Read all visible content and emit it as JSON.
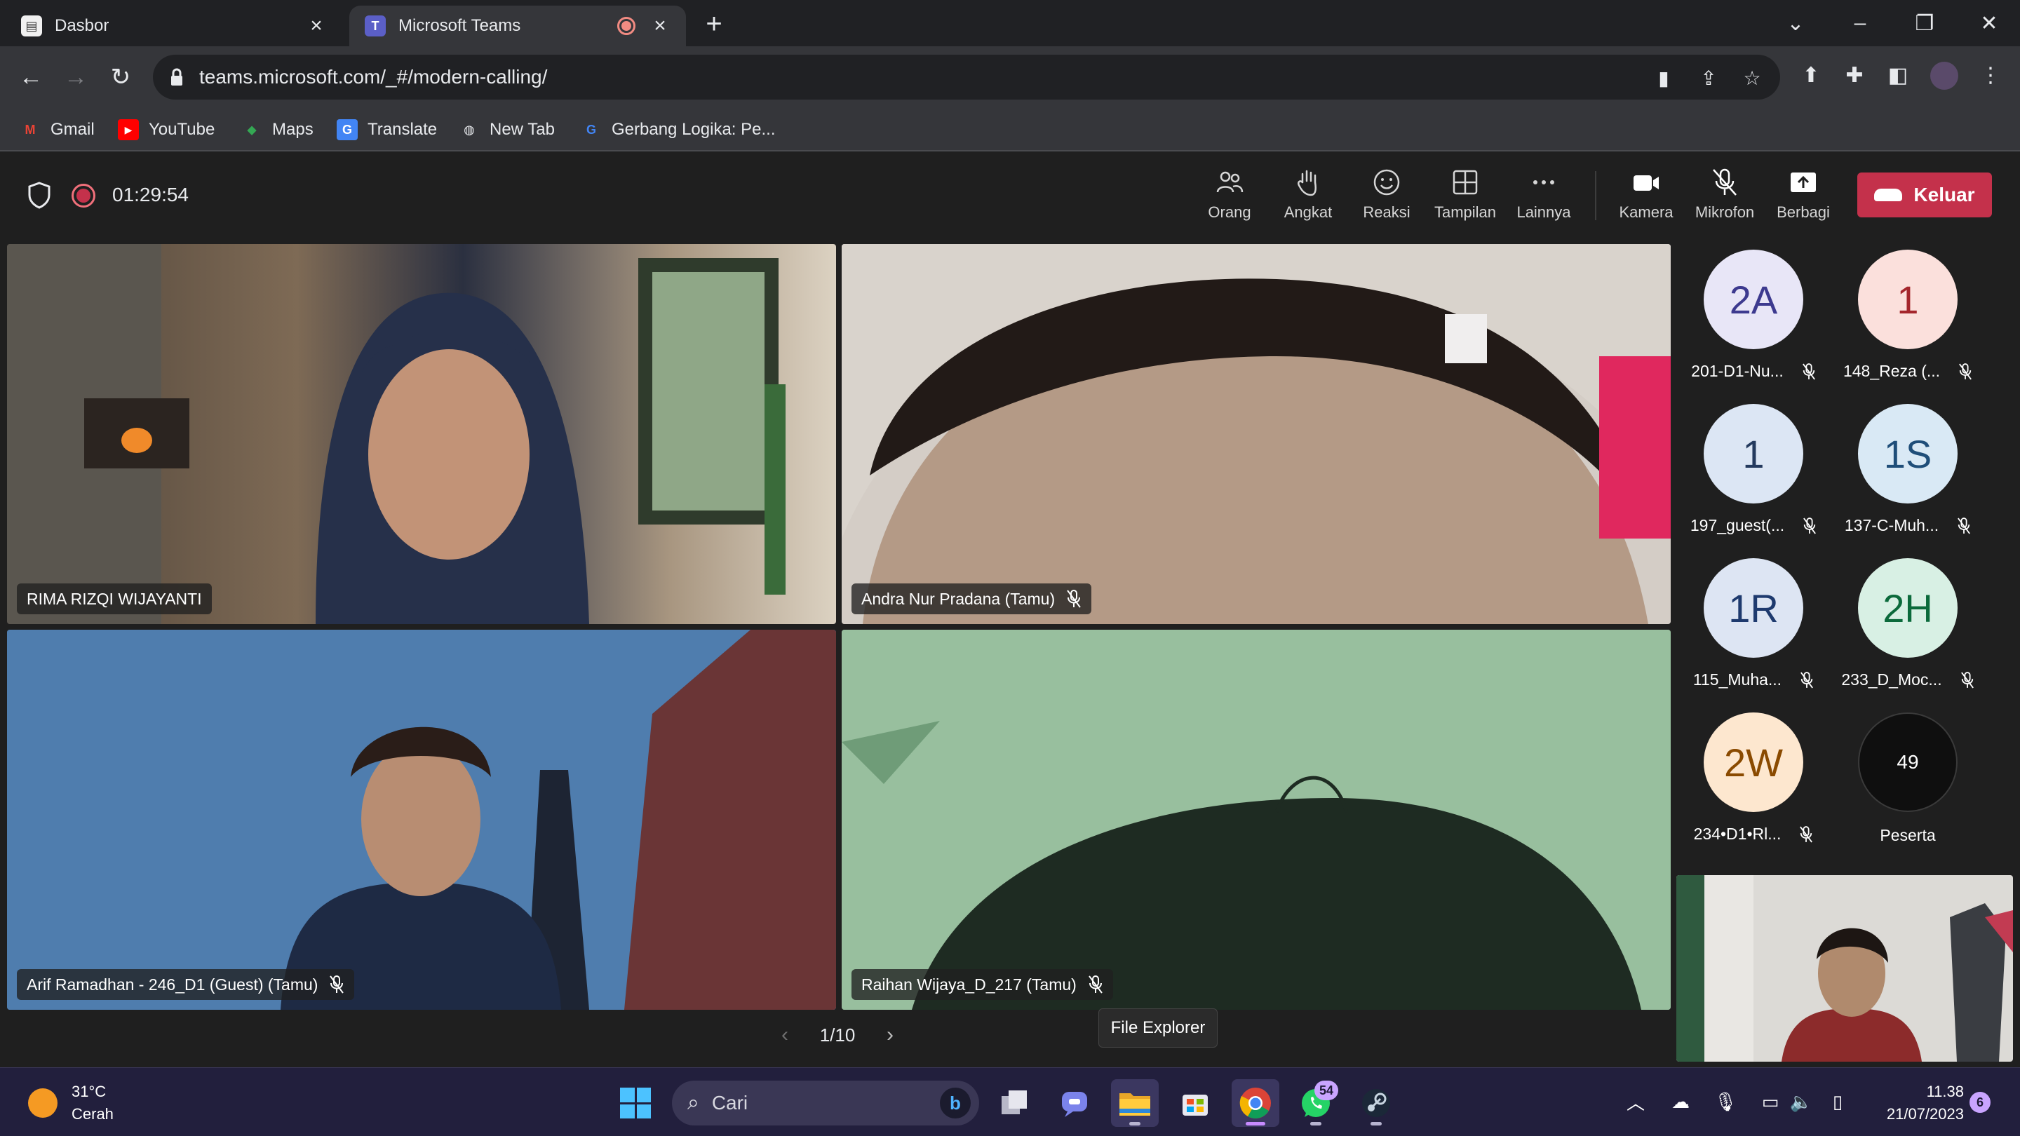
{
  "browser": {
    "tabs": [
      {
        "title": "Dasbor",
        "active": false
      },
      {
        "title": "Microsoft Teams",
        "active": true,
        "recording": true
      }
    ],
    "address": "teams.microsoft.com/_#/modern-calling/",
    "bookmarks": [
      {
        "label": "Gmail",
        "icon": "gmail-icon"
      },
      {
        "label": "YouTube",
        "icon": "youtube-icon"
      },
      {
        "label": "Maps",
        "icon": "maps-icon"
      },
      {
        "label": "Translate",
        "icon": "translate-icon"
      },
      {
        "label": "New Tab",
        "icon": "globe-icon"
      },
      {
        "label": "Gerbang Logika: Pe...",
        "icon": "site-icon"
      }
    ]
  },
  "meeting": {
    "elapsed": "01:29:54",
    "controls": [
      {
        "label": "Orang",
        "icon": "people-icon"
      },
      {
        "label": "Angkat",
        "icon": "raise-hand-icon"
      },
      {
        "label": "Reaksi",
        "icon": "smiley-icon"
      },
      {
        "label": "Tampilan",
        "icon": "layout-grid-icon"
      },
      {
        "label": "Lainnya",
        "icon": "more-icon"
      },
      {
        "label": "Kamera",
        "icon": "camera-icon"
      },
      {
        "label": "Mikrofon",
        "icon": "mic-off-icon"
      },
      {
        "label": "Berbagi",
        "icon": "share-tray-icon"
      }
    ],
    "leave_label": "Keluar",
    "tiles": [
      {
        "name": "RIMA RIZQI WIJAYANTI",
        "muted": false
      },
      {
        "name": "Andra Nur Pradana (Tamu)",
        "muted": true
      },
      {
        "name": "Arif Ramadhan - 246_D1 (Guest) (Tamu)",
        "muted": true
      },
      {
        "name": "Raihan Wijaya_D_217 (Tamu)",
        "muted": true
      }
    ],
    "page": "1/10",
    "roster": [
      {
        "initials": "2A",
        "name": "201-D1-Nu...",
        "bg": "#e8e6f7",
        "fg": "#3d3a8f"
      },
      {
        "initials": "1",
        "name": "148_Reza (...",
        "bg": "#fbe0dc",
        "fg": "#a4262c"
      },
      {
        "initials": "1",
        "name": "197_guest(...",
        "bg": "#dce6f4",
        "fg": "#243a5e"
      },
      {
        "initials": "1S",
        "name": "137-C-Muh...",
        "bg": "#d9e9f5",
        "fg": "#1f4e79"
      },
      {
        "initials": "1R",
        "name": "115_Muha...",
        "bg": "#dde5f3",
        "fg": "#1e3a6e"
      },
      {
        "initials": "2H",
        "name": "233_D_Moc...",
        "bg": "#d8f0e4",
        "fg": "#0b6a3b"
      },
      {
        "initials": "2W",
        "name": "234•D1•Rl...",
        "bg": "#fde7cf",
        "fg": "#8a4a00"
      }
    ],
    "more_participants": {
      "count": "49",
      "label": "Peserta"
    }
  },
  "tooltip": "File Explorer",
  "taskbar": {
    "weather_temp": "31°C",
    "weather_desc": "Cerah",
    "search_placeholder": "Cari",
    "whatsapp_badge": "54",
    "time": "11.38",
    "date": "21/07/2023",
    "notifications": "6"
  }
}
